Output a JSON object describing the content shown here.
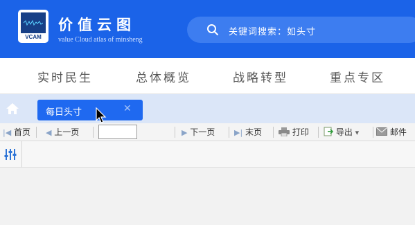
{
  "header": {
    "logo_text": "VCAM",
    "brand_cn": "价值云图",
    "brand_en": "value Cloud atlas of minsheng",
    "search_placeholder": "关键词搜索：如头寸",
    "colors": {
      "header_bg": "#1b63e8",
      "search_bg": "#3d7df0"
    }
  },
  "nav": {
    "items": [
      {
        "label": "实时民生"
      },
      {
        "label": "总体概览"
      },
      {
        "label": "战略转型"
      },
      {
        "label": "重点专区"
      }
    ]
  },
  "tabs": {
    "home_icon": "home-icon",
    "active_tab": {
      "label": "每日头寸",
      "close": "✕"
    }
  },
  "toolbar": {
    "first": "首页",
    "prev": "上一页",
    "page_value": "",
    "next": "下一页",
    "last": "末页",
    "print": "打印",
    "export": "导出",
    "mail": "邮件"
  },
  "filter": {
    "icon": "sliders-icon"
  }
}
